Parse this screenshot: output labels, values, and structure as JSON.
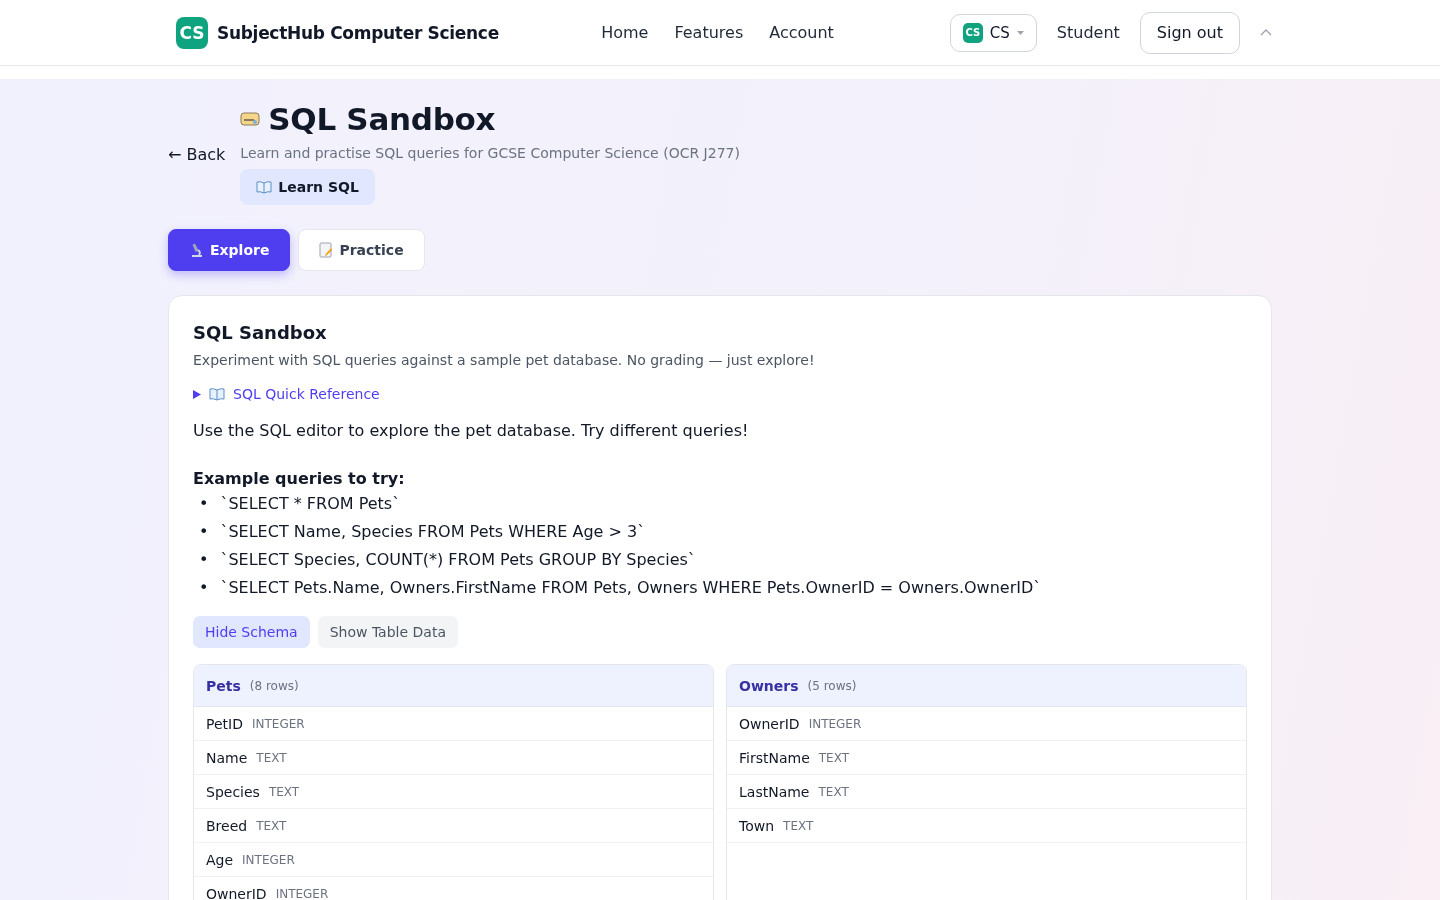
{
  "header": {
    "logo_mark": "CS",
    "brand": "SubjectHub Computer Science",
    "nav": [
      {
        "label": "Home"
      },
      {
        "label": "Features"
      },
      {
        "label": "Account"
      }
    ],
    "subject": {
      "mark": "CS",
      "label": "CS"
    },
    "role": "Student",
    "sign_out": "Sign out"
  },
  "page": {
    "back": "← Back",
    "title": "SQL Sandbox",
    "subtitle": "Learn and practise SQL queries for GCSE Computer Science (OCR J277)",
    "learn_button": "Learn SQL"
  },
  "tabs": [
    {
      "label": "Explore",
      "kind": "explore",
      "selected": true
    },
    {
      "label": "Practice",
      "kind": "practice",
      "selected": false
    }
  ],
  "card": {
    "title": "SQL Sandbox",
    "description": "Experiment with SQL queries against a sample pet database. No grading — just explore!",
    "reference": {
      "label": "SQL Quick Reference",
      "expanded": false
    },
    "intro": "Use the SQL editor to explore the pet database. Try different queries!",
    "examples_heading": "Example queries to try:",
    "examples": [
      {
        "bullet": "•",
        "text": "`SELECT * FROM Pets`"
      },
      {
        "bullet": "•",
        "text": "`SELECT Name, Species FROM Pets WHERE Age > 3`"
      },
      {
        "bullet": "•",
        "text": "`SELECT Species, COUNT(*) FROM Pets GROUP BY Species`"
      },
      {
        "bullet": "•",
        "text": "`SELECT Pets.Name, Owners.FirstName FROM Pets, Owners WHERE Pets.OwnerID = Owners.OwnerID`"
      }
    ],
    "toggles": [
      {
        "label": "Hide Schema",
        "selected": true
      },
      {
        "label": "Show Table Data",
        "selected": false
      }
    ],
    "tables": [
      {
        "name": "Pets",
        "count": "(8 rows)",
        "columns": [
          {
            "name": "PetID",
            "type": "INTEGER"
          },
          {
            "name": "Name",
            "type": "TEXT"
          },
          {
            "name": "Species",
            "type": "TEXT"
          },
          {
            "name": "Breed",
            "type": "TEXT"
          },
          {
            "name": "Age",
            "type": "INTEGER"
          },
          {
            "name": "OwnerID",
            "type": "INTEGER"
          }
        ]
      },
      {
        "name": "Owners",
        "count": "(5 rows)",
        "columns": [
          {
            "name": "OwnerID",
            "type": "INTEGER"
          },
          {
            "name": "FirstName",
            "type": "TEXT"
          },
          {
            "name": "LastName",
            "type": "TEXT"
          },
          {
            "name": "Town",
            "type": "TEXT"
          }
        ]
      }
    ]
  }
}
